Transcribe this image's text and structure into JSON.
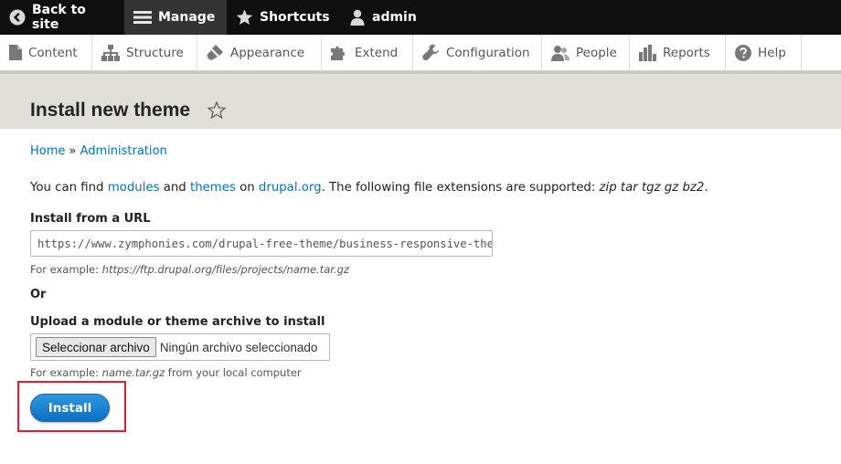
{
  "toolbar": {
    "back_label": "Back to site",
    "manage_label": "Manage",
    "shortcuts_label": "Shortcuts",
    "user_label": "admin"
  },
  "tray": {
    "items": [
      {
        "label": "Content",
        "icon": "file-icon"
      },
      {
        "label": "Structure",
        "icon": "sitemap-icon"
      },
      {
        "label": "Appearance",
        "icon": "brush-icon"
      },
      {
        "label": "Extend",
        "icon": "puzzle-icon"
      },
      {
        "label": "Configuration",
        "icon": "wrench-icon"
      },
      {
        "label": "People",
        "icon": "people-icon"
      },
      {
        "label": "Reports",
        "icon": "bar-chart-icon"
      },
      {
        "label": "Help",
        "icon": "help-icon"
      }
    ]
  },
  "page": {
    "title": "Install new theme"
  },
  "breadcrumb": {
    "home": "Home",
    "separator": " » ",
    "admin": "Administration"
  },
  "info": {
    "part1": "You can find ",
    "modules_link": "modules",
    "part2": " and ",
    "themes_link": "themes",
    "part3": " on ",
    "drupal_link": "drupal.org",
    "part4": ". The following file extensions are supported: ",
    "extensions": "zip tar tgz gz bz2",
    "part5": "."
  },
  "url_field": {
    "label": "Install from a URL",
    "value": "https://www.zymphonies.com/drupal-free-theme/business-responsive-theme",
    "desc_prefix": "For example: ",
    "desc_example": "https://ftp.drupal.org/files/projects/name.tar.gz"
  },
  "or_label": "Or",
  "upload_field": {
    "label": "Upload a module or theme archive to install",
    "button_label": "Seleccionar archivo",
    "status": "Ningún archivo seleccionado",
    "desc_prefix": "For example: ",
    "desc_example": "name.tar.gz",
    "desc_suffix": " from your local computer"
  },
  "install_button": "Install",
  "colors": {
    "toolbar_bg": "#0f0f0f",
    "link": "#0074bd",
    "header_bg": "#e0e0d8",
    "button_blue": "#0a6fc2",
    "highlight_red": "#e8192c"
  }
}
